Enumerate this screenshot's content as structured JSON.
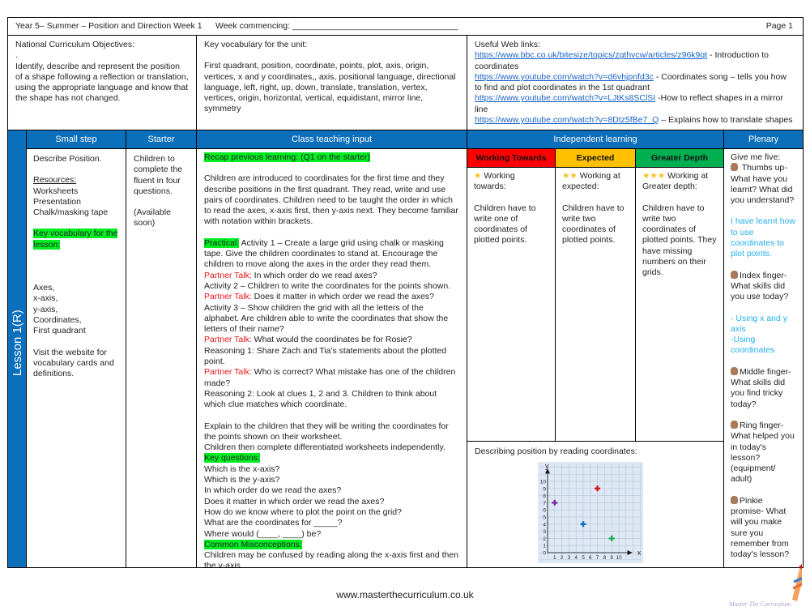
{
  "header": {
    "title": "Year 5– Summer – Position and Direction Week 1",
    "week": "Week commencing: ___________________________________",
    "page": "Page 1"
  },
  "objectives": {
    "heading": "National Curriculum Objectives:",
    "dot": ".",
    "text": "Identify, describe and represent the position of a shape following a reflection or translation, using the appropriate language and know that the shape has not changed."
  },
  "vocab": {
    "heading": "Key vocabulary for the unit:",
    "text": "First quadrant, position, coordinate, points, plot, axis, origin, vertices, x and y coordinates,, axis, positional language, directional language, left, right, up, down, translate, translation, vertex, vertices, origin, horizontal, vertical, equidistant, mirror line, symmetry"
  },
  "links": {
    "heading": "Useful Web links:",
    "items": [
      {
        "url": "https://www.bbc.co.uk/bitesize/topics/zgthvcw/articles/z96k9qt",
        "desc": " - Introduction to coordinates"
      },
      {
        "url": "https://www.youtube.com/watch?v=d6vhjpnfd3c",
        "desc": " - Coordinates song – tells you how to find and plot coordinates in the 1st quadrant"
      },
      {
        "url": "https://www.youtube.com/watch?v=LJtKs8SClSI",
        "desc": " -How to reflect shapes in a mirror line"
      },
      {
        "url": "https://www.youtube.com/watch?v=8Dtz5fBe7_Q",
        "desc": " – Explains how to translate shapes"
      }
    ]
  },
  "columns": {
    "lesson": "Lesson 1(R)",
    "small_step": "Small step",
    "starter": "Starter",
    "teaching": "Class teaching input",
    "independent": "Independent learning",
    "plenary": "Plenary"
  },
  "small_step": {
    "title": "Describe Position.",
    "resources_label": "Resources:",
    "resources": [
      "Worksheets",
      "Presentation",
      "Chalk/masking tape"
    ],
    "vocab_label": "Key vocabulary for the lesson:",
    "vocab": [
      "Axes,",
      "x-axis,",
      "y-axis,",
      "Coordinates,",
      "First quadrant"
    ],
    "visit": "Visit the website for vocabulary cards and definitions."
  },
  "starter": {
    "text": "Children to complete the fluent in four questions.",
    "note": "(Available soon)"
  },
  "teaching": {
    "paragraphs": [
      [
        {
          "label": "Recap previous learning: (Q1 on the starter)",
          "style": "green"
        }
      ],
      [
        {
          "text": "Children are introduced to coordinates for the first time and they describe positions in the first quadrant. They read, write and use pairs of coordinates. Children need to be taught the order in which to read the axes, x-axis first, then y-axis next. They become familiar with notation within brackets."
        }
      ],
      [
        {
          "label": "Practical:",
          "style": "green",
          "text": " Activity 1 – Create a large grid using chalk or masking tape. Give the children coordinates to stand at. Encourage the children to move along the axes in the order they read them."
        },
        {
          "label": "Partner Talk:",
          "style": "red",
          "text": " In which order do we read axes?"
        },
        {
          "text": "Activity 2 – Children to write the coordinates for the points shown."
        },
        {
          "label": "Partner Talk:",
          "style": "red",
          "text": " Does it matter in which order we read the axes?"
        },
        {
          "text": "Activity 3 – Show children the grid with all the letters of the alphabet. Are children able to write the coordinates that show the letters of their name?"
        },
        {
          "label": "Partner Talk:",
          "style": "red",
          "text": " What would the coordinates be for Rosie?"
        },
        {
          "text": "Reasoning 1: Share Zach and Tia's statements about the plotted point."
        },
        {
          "label": "Partner Talk:",
          "style": "red",
          "text": " Who is correct? What mistake has one of the children made?"
        },
        {
          "text": "Reasoning 2: Look at clues 1, 2 and 3. Children to think about which clue matches which coordinate."
        }
      ],
      [
        {
          "text": "Explain to the children that they will be writing the coordinates for the points shown on their worksheet."
        },
        {
          "text": "Children then complete differentiated worksheets independently."
        },
        {
          "label": "Key questions:",
          "style": "green"
        },
        {
          "text": "Which is the x-axis?"
        },
        {
          "text": "Which is the y-axis?"
        },
        {
          "text": "In which order do we read the axes?"
        },
        {
          "text": "Does it matter in which order we read the axes?"
        },
        {
          "text": "How do we know where to plot the point on the grid?"
        },
        {
          "text": "What are the coordinates for _____?"
        },
        {
          "text": "Where would (____, ____) be?"
        },
        {
          "label": "Common Misconceptions:",
          "style": "green"
        },
        {
          "text": "Children may be confused by reading along the x-axis first and then the y-axis."
        }
      ]
    ]
  },
  "independent": {
    "levels": [
      {
        "label": "Working Towards",
        "color": "#ff0000",
        "stars": "★",
        "heading": "Working towards:",
        "text": "Children have to write one of coordinates of plotted points."
      },
      {
        "label": "Expected",
        "color": "#ffc000",
        "stars": "★★",
        "heading": "Working at expected:",
        "text": "Children have to write two coordinates of plotted points."
      },
      {
        "label": "Greater Depth",
        "color": "#00b050",
        "stars": "★★★",
        "heading": "Working at Greater depth:",
        "text": "Children have to write two coordinates of plotted points. They have missing numbers on their grids."
      }
    ],
    "chart_caption": "Describing position by reading coordinates:"
  },
  "chart_data": {
    "type": "scatter",
    "xlabel": "x",
    "ylabel": "y",
    "xlim": [
      0,
      10
    ],
    "ylim": [
      0,
      10
    ],
    "grid": true,
    "x_ticks": [
      "1",
      "2",
      "3",
      "4",
      "5",
      "6",
      "7",
      "8",
      "9",
      "10"
    ],
    "y_ticks": [
      "0",
      "1",
      "2",
      "3",
      "4",
      "5",
      "6",
      "7",
      "8",
      "9",
      "10"
    ],
    "points": [
      {
        "x": 1,
        "y": 7,
        "color": "#7b2fa6"
      },
      {
        "x": 7,
        "y": 9,
        "color": "#d7141b"
      },
      {
        "x": 5,
        "y": 4,
        "color": "#0a6fc8"
      },
      {
        "x": 9,
        "y": 2,
        "color": "#1cb04a"
      }
    ]
  },
  "plenary": {
    "intro": "Give me five:",
    "items": [
      {
        "lead": " Thumbs up-",
        "text": "What have you learnt? What did you understand?",
        "answer": "I have learnt how to use coordinates to plot points."
      },
      {
        "lead": "Index finger-",
        "text": "What skills did you use today?",
        "answer": "- Using x and y axis\n-Using coordinates"
      },
      {
        "lead": "Middle finger-",
        "text": "What skills did you find tricky today?"
      },
      {
        "lead": "Ring finger-",
        "text": "What helped you in today's lesson? (equipment/ adult)"
      },
      {
        "lead": "Pinkie",
        "text": "promise- What will you make sure you remember from today's lesson?"
      }
    ]
  },
  "footer": {
    "url": "www.masterthecurriculum.co.uk",
    "logo_text": "Master The Curriculum"
  }
}
